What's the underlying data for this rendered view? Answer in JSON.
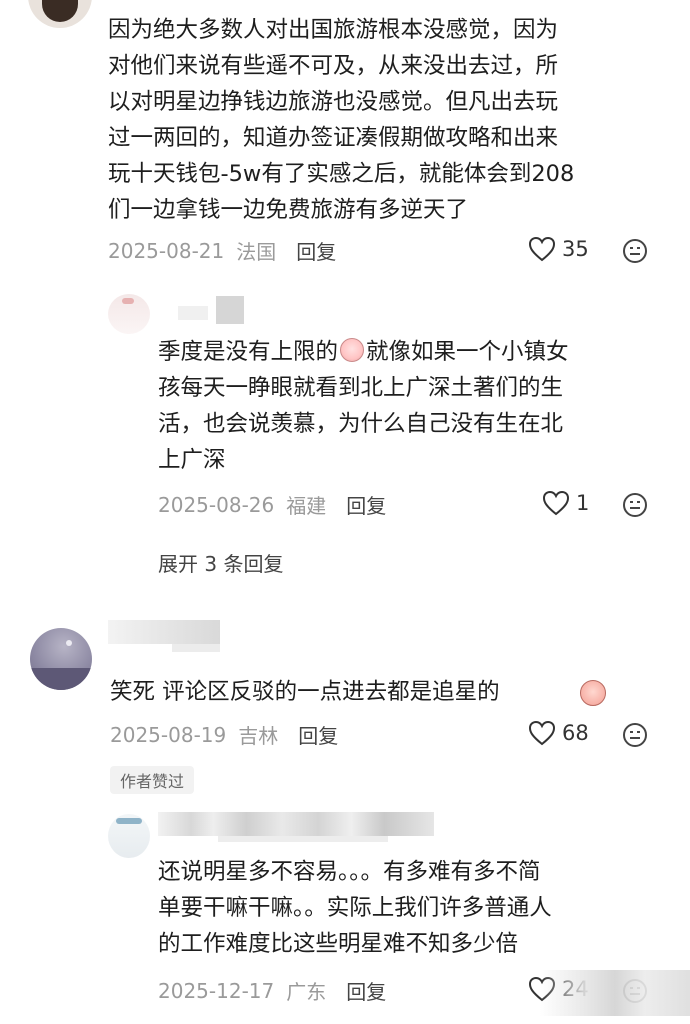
{
  "comment1": {
    "lines": [
      "因为绝大多数人对出国旅游根本没感觉，因为",
      "对他们来说有些遥不可及，从来没出去过，所",
      "以对明星边挣钱边旅游也没感觉。但凡出去玩",
      "过一两回的，知道办签证凑假期做攻略和出来",
      "玩十天钱包-5w有了实感之后，就能体会到208",
      "们一边拿钱一边免费旅游有多逆天了"
    ],
    "date": "2025-08-21",
    "location": "法国",
    "reply_label": "回复",
    "likes": "35"
  },
  "reply1": {
    "line1_a": "季度是没有上限的",
    "line1_b": "就像如果一个小镇女",
    "lines": [
      "孩每天一睁眼就看到北上广深土著们的生",
      "活，也会说羡慕，为什么自己没有生在北",
      "上广深"
    ],
    "date": "2025-08-26",
    "location": "福建",
    "reply_label": "回复",
    "likes": "1"
  },
  "expand_replies": "展开 3 条回复",
  "comment2": {
    "text": "笑死 评论区反驳的一点进去都是追星的",
    "date": "2025-08-19",
    "location": "吉林",
    "reply_label": "回复",
    "likes": "68",
    "author_liked": "作者赞过"
  },
  "reply2": {
    "lines": [
      "还说明星多不容易。。。有多难有多不简",
      "单要干嘛干嘛。。实际上我们许多普通人",
      "的工作难度比这些明星难不知多少倍"
    ],
    "date": "2025-12-17",
    "location": "广东",
    "reply_label": "回复",
    "likes": "24"
  },
  "colors": {
    "meta": "#9a9a9a",
    "text": "#1e1e1e",
    "heart_stroke": "#333333"
  },
  "icons": [
    "heart-icon",
    "dislike-face-icon",
    "laugh-cry-emoji",
    "smirk-emoji"
  ]
}
